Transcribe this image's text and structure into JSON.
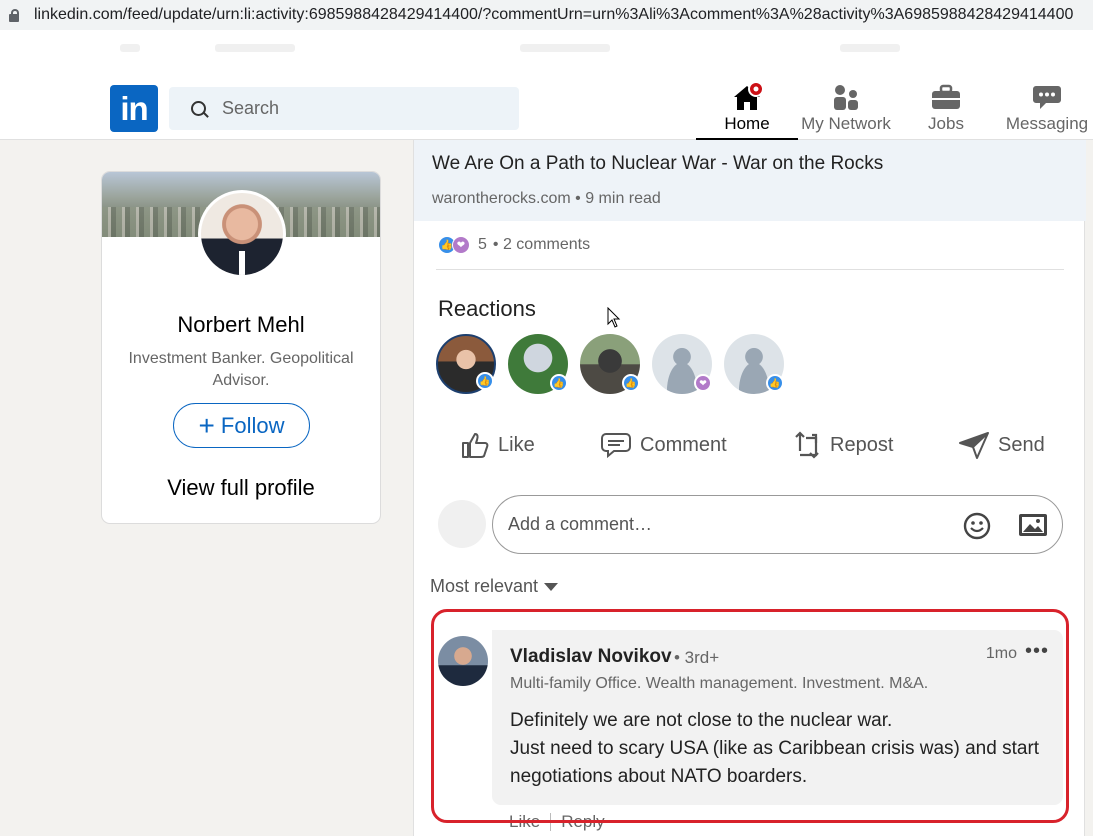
{
  "browser": {
    "url": "linkedin.com/feed/update/urn:li:activity:6985988428429414400/?commentUrn=urn%3Ali%3Acomment%3A%28activity%3A6985988428429414400"
  },
  "nav": {
    "logo_text": "in",
    "search_placeholder": "Search",
    "items": [
      {
        "label": "Home",
        "icon": "home-icon"
      },
      {
        "label": "My Network",
        "icon": "network-icon"
      },
      {
        "label": "Jobs",
        "icon": "briefcase-icon"
      },
      {
        "label": "Messaging",
        "icon": "messaging-icon"
      }
    ]
  },
  "profile": {
    "name": "Norbert Mehl",
    "headline": "Investment Banker. Geopolitical Advisor.",
    "follow_plus": "+",
    "follow_label": "Follow",
    "view_profile": "View full profile"
  },
  "post": {
    "article_title": "We Are On a Path to Nuclear War - War on the Rocks",
    "article_source": "warontherocks.com • 9 min read",
    "reaction_count": "5",
    "comments_count": "• 2 comments",
    "reactions_title": "Reactions",
    "actions": {
      "like": "Like",
      "comment": "Comment",
      "repost": "Repost",
      "send": "Send"
    },
    "comment_placeholder": "Add a comment…",
    "sort_label": "Most relevant"
  },
  "comment": {
    "author": "Vladislav Novikov",
    "degree": "• 3rd+",
    "time": "1mo",
    "more": "•••",
    "headline": "Multi-family Office. Wealth management. Investment. M&A.",
    "text_line1": "Definitely we are not close to the nuclear war.",
    "text_line2": "Just need to scary USA (like as Caribbean crisis was) and start negotiations about NATO boarders.",
    "like_label": "Like",
    "reply_label": "Reply"
  },
  "colors": {
    "brand": "#0a66c2",
    "highlight": "#d8222b",
    "like": "#378fe9",
    "love": "#b27ac9"
  }
}
